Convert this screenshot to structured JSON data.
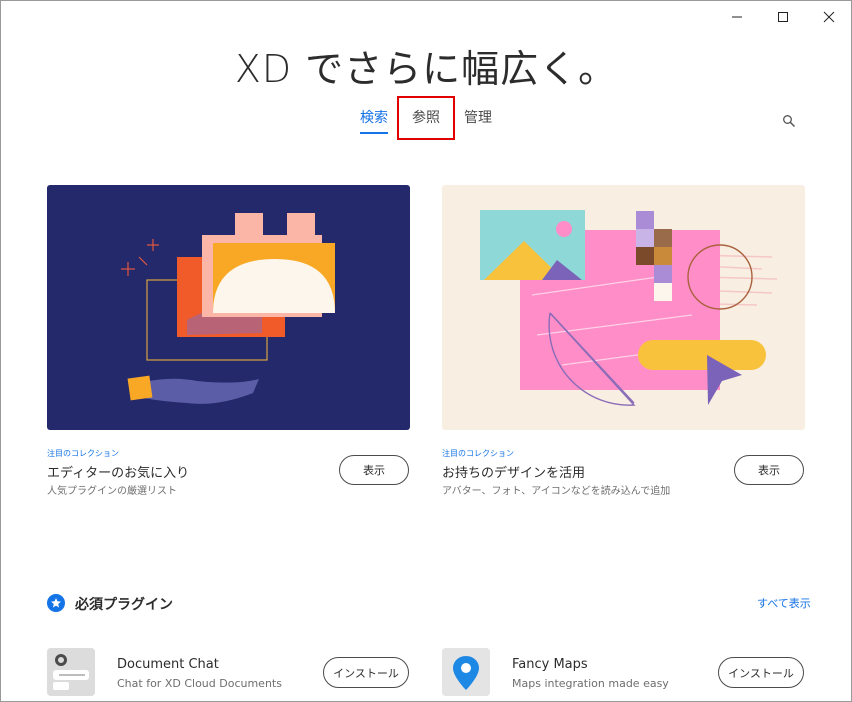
{
  "window": {
    "controls": [
      "minimize",
      "maximize",
      "close"
    ]
  },
  "hero": {
    "title": "XD でさらに幅広く。"
  },
  "tabs": [
    {
      "label": "検索",
      "active": true
    },
    {
      "label": "参照",
      "active": false
    },
    {
      "label": "管理",
      "active": false
    }
  ],
  "cards": [
    {
      "kicker": "注目のコレクション",
      "title": "エディターのお気に入り",
      "subtitle": "人気プラグインの厳選リスト",
      "button": "表示"
    },
    {
      "kicker": "注目のコレクション",
      "title": "お持ちのデザインを活用",
      "subtitle": "アバター、フォト、アイコンなどを読み込んで追加",
      "button": "表示"
    }
  ],
  "section": {
    "title": "必須プラグイン",
    "see_all": "すべて表示"
  },
  "plugins": [
    {
      "name": "Document Chat",
      "description": "Chat for XD Cloud Documents",
      "button": "インストール"
    },
    {
      "name": "Fancy Maps",
      "description": "Maps integration made easy",
      "button": "インストール"
    }
  ],
  "colors": {
    "accent": "#1473e6",
    "highlight": "#e00000"
  }
}
